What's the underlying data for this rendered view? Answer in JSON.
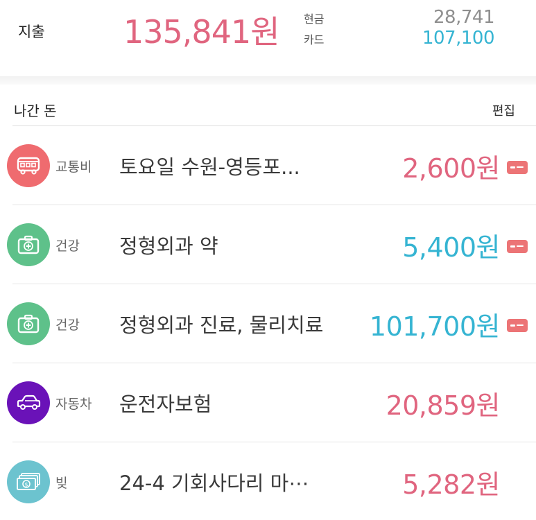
{
  "summary": {
    "label": "지출",
    "total": "135,841원",
    "cash_label": "현금",
    "cash_value": "28,741",
    "card_label": "카드",
    "card_value": "107,100"
  },
  "section": {
    "title": "나간 돈",
    "edit_label": "편집"
  },
  "colors": {
    "expense_pink": "#e0657f",
    "cash_blue": "#35b4d2",
    "transport": "#ef6b6f",
    "health": "#5ec18a",
    "car": "#6a12b8",
    "debt": "#6cc3cf",
    "card_badge": "#ec7476"
  },
  "transactions": [
    {
      "category": "교통비",
      "icon": "bus-icon",
      "title": "토요일 수원-영등포...",
      "amount": "2,600원",
      "amount_color": "pink",
      "payment": "card"
    },
    {
      "category": "건강",
      "icon": "medical-kit-icon",
      "title": "정형외과 약",
      "amount": "5,400원",
      "amount_color": "blue",
      "payment": "card"
    },
    {
      "category": "건강",
      "icon": "medical-kit-icon",
      "title": "정형외과 진료, 물리치료",
      "amount": "101,700원",
      "amount_color": "blue",
      "payment": "card"
    },
    {
      "category": "자동차",
      "icon": "car-icon",
      "title": "운전자보험",
      "amount": "20,859원",
      "amount_color": "pink",
      "payment": ""
    },
    {
      "category": "빚",
      "icon": "money-icon",
      "title": "24-4 기회사다리 마⋯",
      "amount": "5,282원",
      "amount_color": "pink",
      "payment": ""
    }
  ]
}
